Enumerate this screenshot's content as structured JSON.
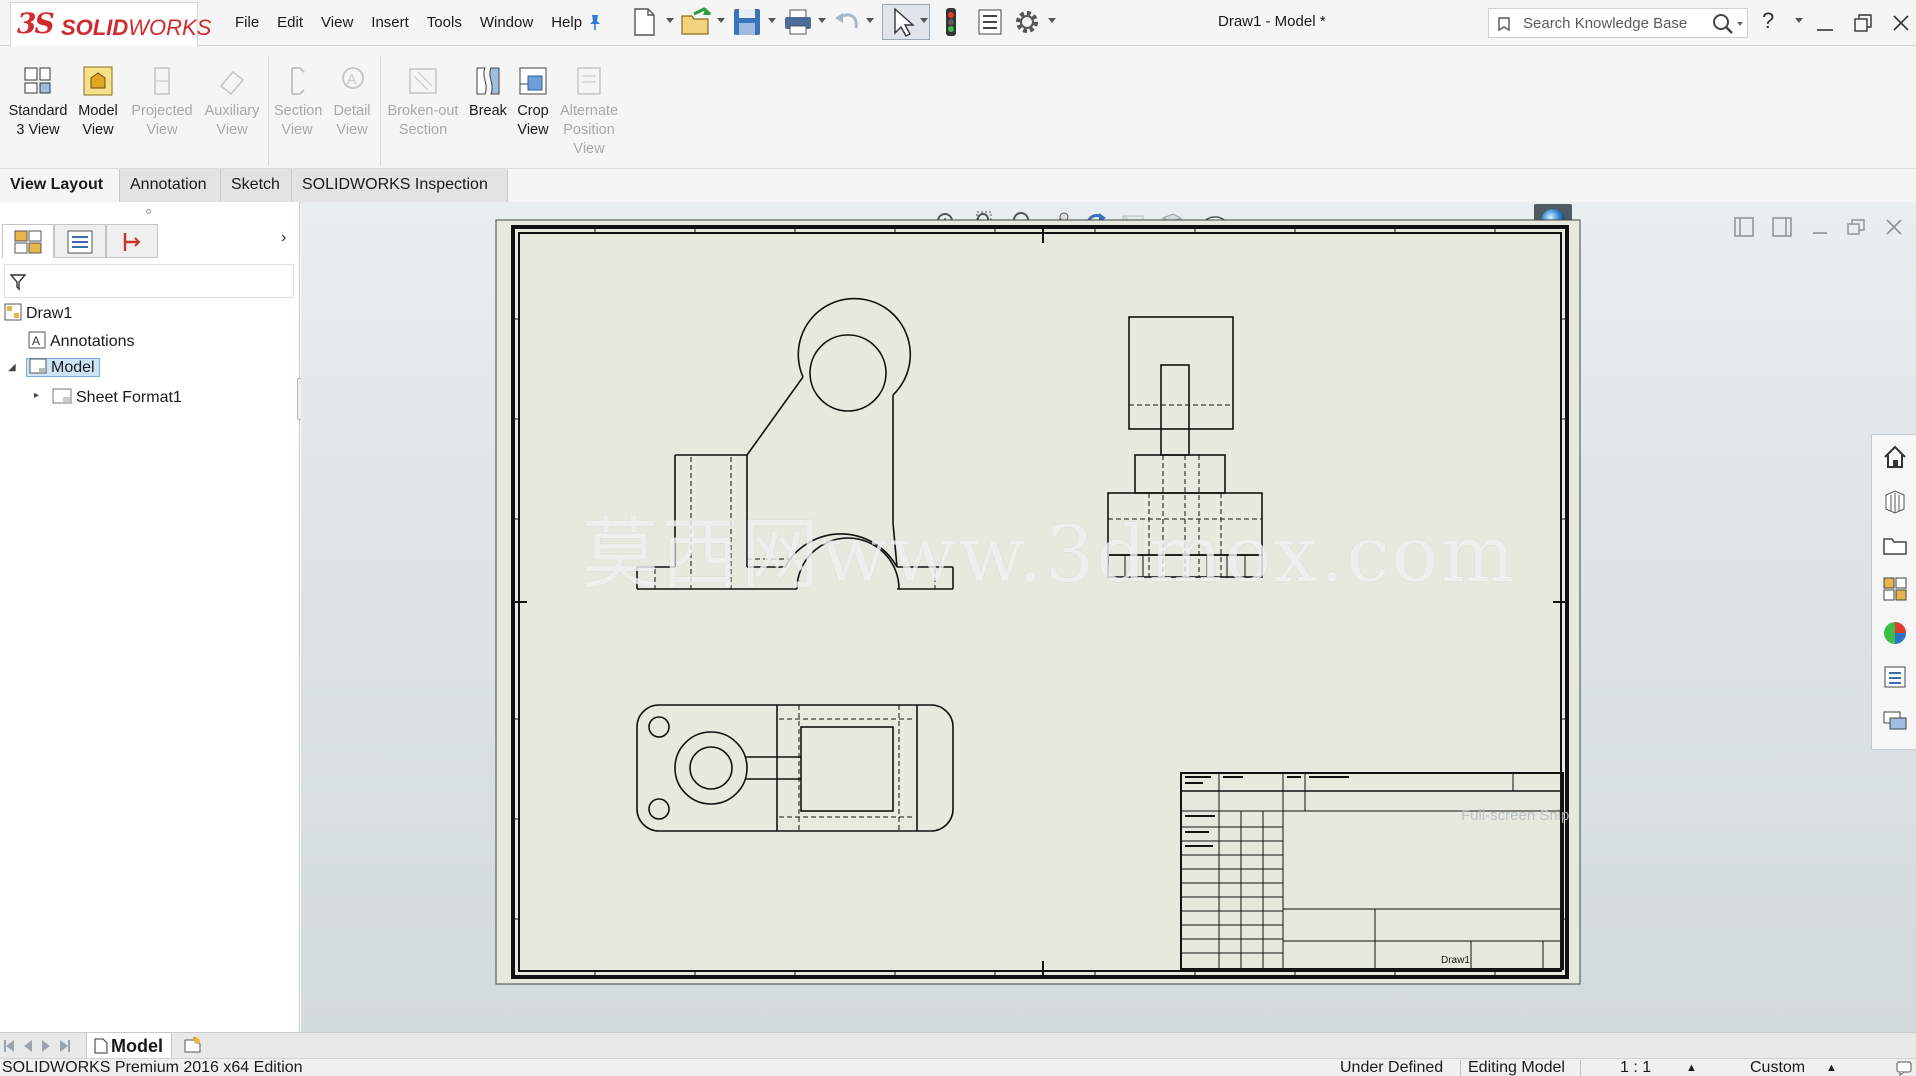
{
  "app": {
    "logo_ds": "3S",
    "logo_text_bold": "SOLID",
    "logo_text_thin": "WORKS",
    "document_title": "Draw1 - Model *"
  },
  "menu": [
    "File",
    "Edit",
    "View",
    "Insert",
    "Tools",
    "Window",
    "Help"
  ],
  "search": {
    "placeholder": "Search Knowledge Base"
  },
  "help_label": "?",
  "commands": [
    {
      "label": "Standard 3 View",
      "enabled": true
    },
    {
      "label": "Model View",
      "enabled": true
    },
    {
      "label": "Projected View",
      "enabled": false
    },
    {
      "label": "Auxiliary View",
      "enabled": false
    },
    {
      "label": "Section View",
      "enabled": false
    },
    {
      "label": "Detail View",
      "enabled": false
    },
    {
      "label": "Broken-out Section",
      "enabled": false
    },
    {
      "label": "Break",
      "enabled": true
    },
    {
      "label": "Crop View",
      "enabled": true
    },
    {
      "label": "Alternate Position View",
      "enabled": false
    }
  ],
  "tabs": [
    {
      "label": "View Layout",
      "active": true
    },
    {
      "label": "Annotation",
      "active": false
    },
    {
      "label": "Sketch",
      "active": false
    },
    {
      "label": "SOLIDWORKS Inspection",
      "active": false
    }
  ],
  "tree": {
    "root": "Draw1",
    "annotations": "Annotations",
    "sheet": "Model",
    "sheet_format": "Sheet Format1"
  },
  "sheet_tab": "Model",
  "watermark": "莫西网www.3dmox.com",
  "ghost_text": "Full-screen Snip",
  "title_block": {
    "drawing_name": "Draw1"
  },
  "status": {
    "product": "SOLIDWORKS Premium 2016 x64 Edition",
    "definition": "Under Defined",
    "mode": "Editing Model",
    "scale": "1 : 1",
    "units": "Custom"
  },
  "colors": {
    "accent_red": "#d12a2f",
    "sheet_paper": "#e8e9de",
    "selection": "#cfe3f7",
    "disabled_text": "#a9a9a9"
  }
}
